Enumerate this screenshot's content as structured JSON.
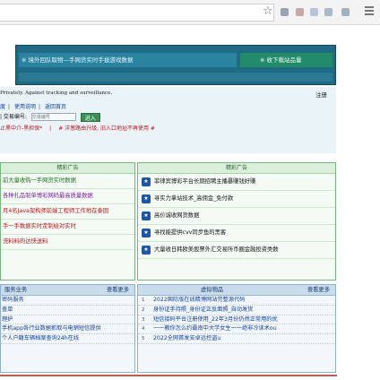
{
  "browser": {
    "star_icon": "star-icon",
    "menu_icon": "hamburger-menu-icon",
    "extension_colors": [
      "#9aa3b5",
      "#c7a6a6",
      "#b7c4d9",
      "#a9b9c9",
      "#9fb1c4"
    ]
  },
  "banner": {
    "left_text": "※ 境外回队取物—手网货实时手拔游戏数据",
    "right_text": "※ 收下载站品量"
  },
  "info": {
    "notice": "Privately. Against tracking and surveillance.",
    "note_right": "注册",
    "links": [
      "度",
      "使用说明",
      "返回首页"
    ],
    "trade_label": "| 交易编号:",
    "trade_placeholder": "交易编号",
    "trade_button": "进入",
    "warn_left": "止黑中介-黑担保*",
    "warn_sep": "|",
    "warn_right": "# 洋葱路由升级, 旧入口地址不再使用 #"
  },
  "ads_left": {
    "header": "精彩广告",
    "rows": [
      {
        "text": "前大量收购一手网货实时数据",
        "color": "c-green"
      },
      {
        "text": "各种扎品制单博彩网码最高质量数据",
        "color": "c-purple"
      },
      {
        "text": "月4名Java架构师前端工程师工作地在泰国",
        "color": "c-red"
      },
      {
        "text": "手一手数据实时定制给对实时",
        "color": "c-red"
      },
      {
        "text": "洗料料的达快送料",
        "color": "c-red"
      }
    ]
  },
  "ads_right": {
    "header": "精彩广告",
    "rows": [
      {
        "icon": "★",
        "text": "菲律宾博彩平台长期招聘主播暴赚钱好赚"
      },
      {
        "icon": "★",
        "text": "寻实力拿站技术_高佣金_免付款"
      },
      {
        "icon": "★",
        "text": "高价诚收网货数据"
      },
      {
        "icon": "★",
        "text": "寻找能提供cvv同步鱼的黑客"
      },
      {
        "icon": "★",
        "text": "大量收日韩欧美股票外汇交易所币圈金融投资类数"
      }
    ]
  },
  "list_left": {
    "title": "服务业务",
    "more": "查看更多",
    "items": [
      "密码服务",
      "查单",
      "理护",
      "手机app各行业数据抓取与电销短信提供",
      "个人户籍车辆档案查询24h在线"
    ]
  },
  "list_right": {
    "title": "虚拟物品",
    "more": "查看更多",
    "items": [
      {
        "num": "1",
        "text": "2022国际版在线精博网站完整源代码"
      },
      {
        "num": "2",
        "text": "身份证手持照_身份证正反面照_自动发货"
      },
      {
        "num": "3",
        "text": "短信接码平台注册使用_22年3月份仍然正常用的优"
      },
      {
        "num": "4",
        "text": "一一教你怎么约霸南中大学女生一一绝非冷读术ou"
      },
      {
        "num": "5",
        "text": "2022全网首发安卓远控盗u"
      }
    ]
  }
}
